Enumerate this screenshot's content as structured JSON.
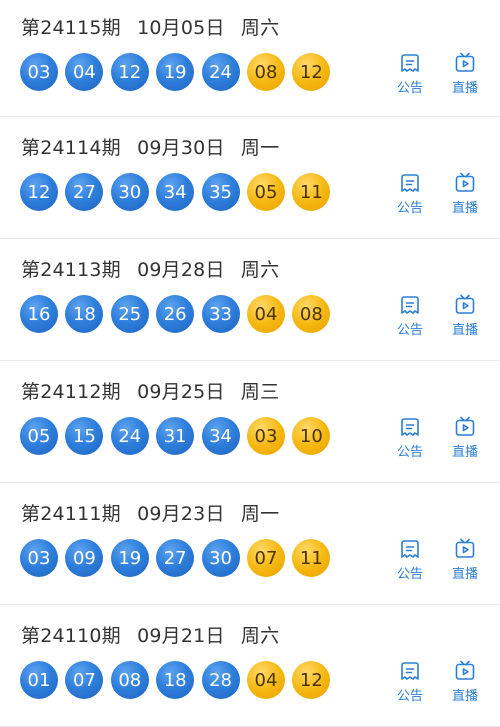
{
  "actions": {
    "notice_label": "公告",
    "live_label": "直播"
  },
  "draws": [
    {
      "issue": "第24115期",
      "date": "10月05日",
      "weekday": "周六",
      "red": [
        "03",
        "04",
        "12",
        "19",
        "24"
      ],
      "blue": [
        "08",
        "12"
      ]
    },
    {
      "issue": "第24114期",
      "date": "09月30日",
      "weekday": "周一",
      "red": [
        "12",
        "27",
        "30",
        "34",
        "35"
      ],
      "blue": [
        "05",
        "11"
      ]
    },
    {
      "issue": "第24113期",
      "date": "09月28日",
      "weekday": "周六",
      "red": [
        "16",
        "18",
        "25",
        "26",
        "33"
      ],
      "blue": [
        "04",
        "08"
      ]
    },
    {
      "issue": "第24112期",
      "date": "09月25日",
      "weekday": "周三",
      "red": [
        "05",
        "15",
        "24",
        "31",
        "34"
      ],
      "blue": [
        "03",
        "10"
      ]
    },
    {
      "issue": "第24111期",
      "date": "09月23日",
      "weekday": "周一",
      "red": [
        "03",
        "09",
        "19",
        "27",
        "30"
      ],
      "blue": [
        "07",
        "11"
      ]
    },
    {
      "issue": "第24110期",
      "date": "09月21日",
      "weekday": "周六",
      "red": [
        "01",
        "07",
        "08",
        "18",
        "28"
      ],
      "blue": [
        "04",
        "12"
      ]
    }
  ],
  "icons": {
    "notice": "notice-document-icon",
    "live": "tv-play-icon"
  },
  "colors": {
    "front_ball": "#2f7fdc",
    "back_ball": "#f6b812",
    "action": "#2a7ed8"
  }
}
